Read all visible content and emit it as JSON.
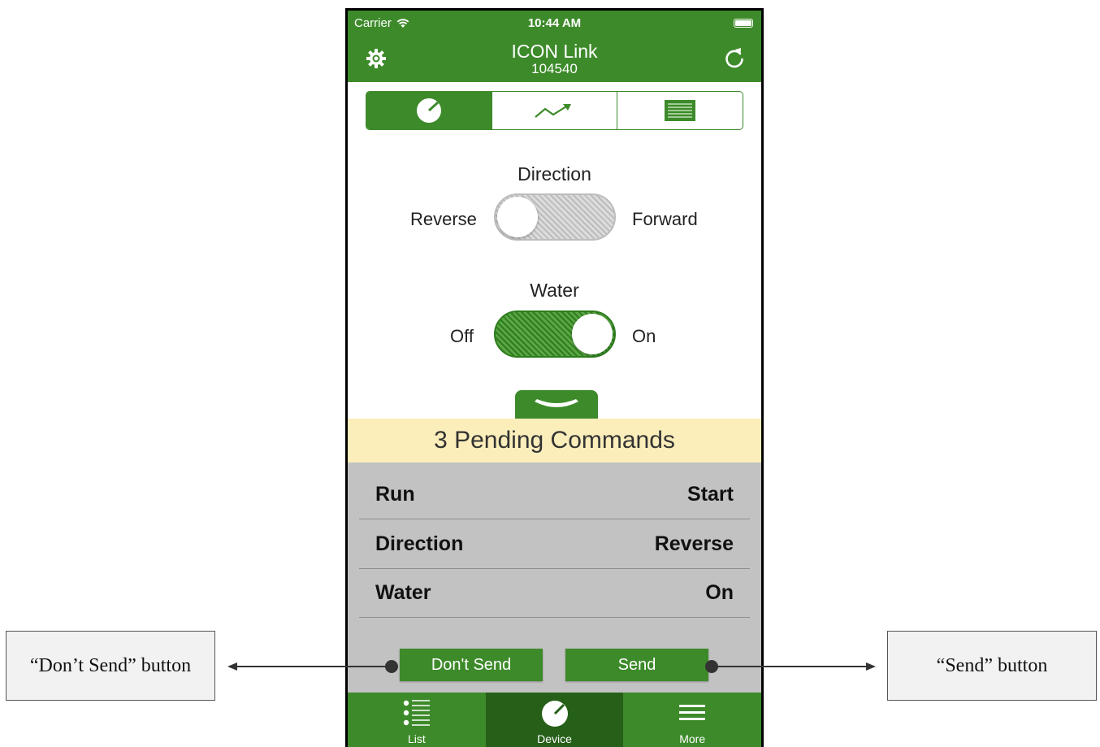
{
  "status_bar": {
    "carrier": "Carrier",
    "time": "10:44 AM"
  },
  "header": {
    "title": "ICON Link",
    "subtitle": "104540"
  },
  "segments": [
    {
      "icon": "gauge-icon",
      "selected": true
    },
    {
      "icon": "trend-chart-icon",
      "selected": false
    },
    {
      "icon": "table-list-icon",
      "selected": false
    }
  ],
  "direction": {
    "label": "Direction",
    "left": "Reverse",
    "right": "Forward",
    "state": "Reverse"
  },
  "water": {
    "label": "Water",
    "left": "Off",
    "right": "On",
    "state": "On"
  },
  "pending": {
    "title": "3 Pending Commands",
    "commands": [
      {
        "name": "Run",
        "value": "Start"
      },
      {
        "name": "Direction",
        "value": "Reverse"
      },
      {
        "name": "Water",
        "value": "On"
      }
    ],
    "dont_send_label": "Don't Send",
    "send_label": "Send"
  },
  "tabs": [
    {
      "label": "List",
      "icon": "list-icon",
      "active": false
    },
    {
      "label": "Device",
      "icon": "gauge-icon",
      "active": true
    },
    {
      "label": "More",
      "icon": "menu-icon",
      "active": false
    }
  ],
  "annotations": {
    "dont_send": "“Don’t Send” button",
    "send": "“Send” button"
  },
  "colors": {
    "primary_green": "#3d8a2a",
    "active_tab": "#265f18",
    "pending_header": "#fbeebb",
    "pending_body": "#c2c2c2"
  }
}
